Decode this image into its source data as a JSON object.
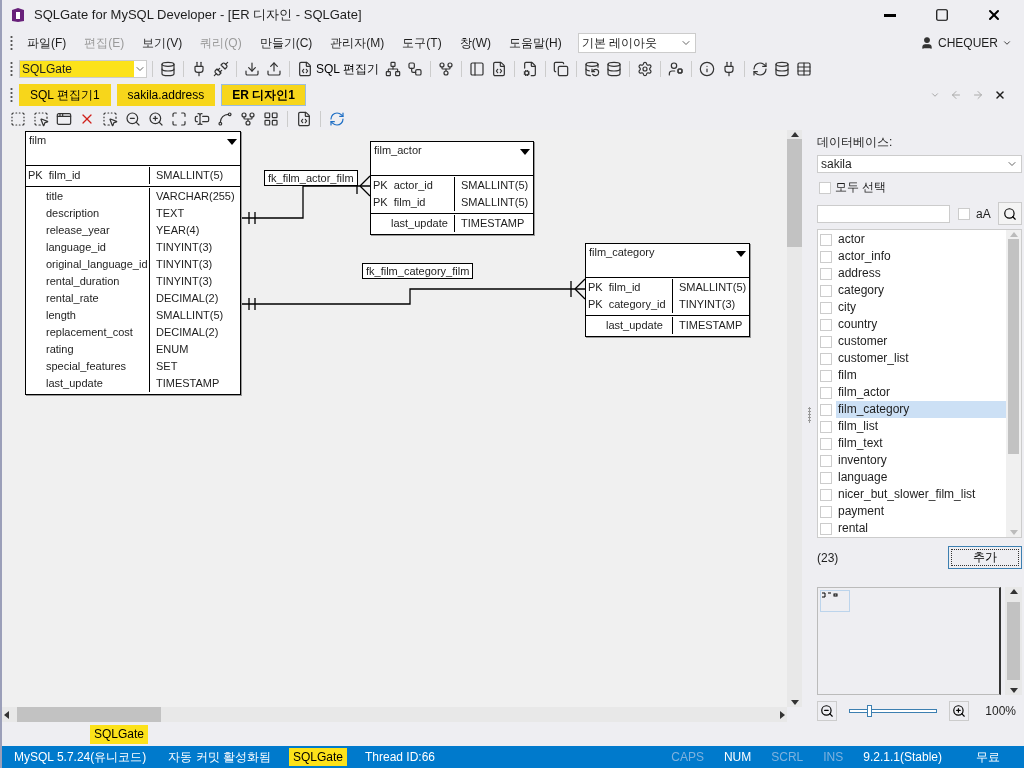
{
  "window": {
    "title": "SQLGate for MySQL Developer - [ER 디자인 - SQLGate]"
  },
  "menu": {
    "items": [
      {
        "label": "파일(F)",
        "disabled": false
      },
      {
        "label": "편집(E)",
        "disabled": true
      },
      {
        "label": "보기(V)",
        "disabled": false
      },
      {
        "label": "쿼리(Q)",
        "disabled": true
      },
      {
        "label": "만들기(C)",
        "disabled": false
      },
      {
        "label": "관리자(M)",
        "disabled": false
      },
      {
        "label": "도구(T)",
        "disabled": false
      },
      {
        "label": "창(W)",
        "disabled": false
      },
      {
        "label": "도움말(H)",
        "disabled": false
      }
    ],
    "layout_select": "기본 레이아웃",
    "user": "CHEQUER"
  },
  "toolbar": {
    "connection": "SQLGate",
    "sql_editor": "SQL 편집기"
  },
  "doc_tabs": [
    {
      "label": "SQL 편집기1",
      "selected": false
    },
    {
      "label": "sakila.address",
      "selected": false
    },
    {
      "label": "ER 디자인1",
      "selected": true
    }
  ],
  "er": {
    "tables": [
      {
        "name": "film",
        "columns": [
          {
            "key": "PK",
            "name": "film_id",
            "type": "SMALLINT(5)"
          },
          {
            "name": "title",
            "type": "VARCHAR(255)"
          },
          {
            "name": "description",
            "type": "TEXT"
          },
          {
            "name": "release_year",
            "type": "YEAR(4)"
          },
          {
            "name": "language_id",
            "type": "TINYINT(3)"
          },
          {
            "name": "original_language_id",
            "type": "TINYINT(3)"
          },
          {
            "name": "rental_duration",
            "type": "TINYINT(3)"
          },
          {
            "name": "rental_rate",
            "type": "DECIMAL(2)"
          },
          {
            "name": "length",
            "type": "SMALLINT(5)"
          },
          {
            "name": "replacement_cost",
            "type": "DECIMAL(2)"
          },
          {
            "name": "rating",
            "type": "ENUM"
          },
          {
            "name": "special_features",
            "type": "SET"
          },
          {
            "name": "last_update",
            "type": "TIMESTAMP"
          }
        ]
      },
      {
        "name": "film_actor",
        "columns": [
          {
            "key": "PK",
            "name": "actor_id",
            "type": "SMALLINT(5)"
          },
          {
            "key": "PK",
            "name": "film_id",
            "type": "SMALLINT(5)"
          },
          {
            "name": "last_update",
            "type": "TIMESTAMP"
          }
        ]
      },
      {
        "name": "film_category",
        "columns": [
          {
            "key": "PK",
            "name": "film_id",
            "type": "SMALLINT(5)"
          },
          {
            "key": "PK",
            "name": "category_id",
            "type": "TINYINT(3)"
          },
          {
            "name": "last_update",
            "type": "TIMESTAMP"
          }
        ]
      }
    ],
    "relations": [
      {
        "label": "fk_film_actor_film"
      },
      {
        "label": "fk_film_category_film"
      }
    ]
  },
  "side_panel": {
    "database_label": "데이터베이스:",
    "database": "sakila",
    "select_all": {
      "label": "모두 선택",
      "checked": false
    },
    "case_toggle": {
      "label": "aA",
      "checked": false
    },
    "tables": [
      {
        "name": "actor",
        "checked": false,
        "selected": false
      },
      {
        "name": "actor_info",
        "checked": false,
        "selected": false
      },
      {
        "name": "address",
        "checked": false,
        "selected": false
      },
      {
        "name": "category",
        "checked": false,
        "selected": false
      },
      {
        "name": "city",
        "checked": false,
        "selected": false
      },
      {
        "name": "country",
        "checked": false,
        "selected": false
      },
      {
        "name": "customer",
        "checked": false,
        "selected": false
      },
      {
        "name": "customer_list",
        "checked": false,
        "selected": false
      },
      {
        "name": "film",
        "checked": false,
        "selected": false
      },
      {
        "name": "film_actor",
        "checked": false,
        "selected": false
      },
      {
        "name": "film_category",
        "checked": false,
        "selected": true
      },
      {
        "name": "film_list",
        "checked": false,
        "selected": false
      },
      {
        "name": "film_text",
        "checked": false,
        "selected": false
      },
      {
        "name": "inventory",
        "checked": false,
        "selected": false
      },
      {
        "name": "language",
        "checked": false,
        "selected": false
      },
      {
        "name": "nicer_but_slower_film_list",
        "checked": false,
        "selected": false
      },
      {
        "name": "payment",
        "checked": false,
        "selected": false
      },
      {
        "name": "rental",
        "checked": false,
        "selected": false
      }
    ],
    "count": "(23)",
    "add_button": "추가",
    "zoom": {
      "level": 0.23,
      "reading": "100%"
    }
  },
  "bottom_tabs": [
    {
      "label": "SQLGate",
      "selected": true
    }
  ],
  "status_bar": {
    "left": [
      {
        "text": "MySQL 5.7.24(유니코드)",
        "kind": "plain"
      },
      {
        "text": "자동 커밋 활성화됨",
        "kind": "plain"
      },
      {
        "text": "SQLGate",
        "kind": "highlight"
      },
      {
        "text": "Thread ID:66",
        "kind": "plain"
      }
    ],
    "right": [
      {
        "text": "CAPS",
        "active": false
      },
      {
        "text": "NUM",
        "active": true
      },
      {
        "text": "SCRL",
        "active": false
      },
      {
        "text": "INS",
        "active": false
      },
      {
        "text": "9.2.1.1(Stable)",
        "active": true
      },
      {
        "text": "무료",
        "active": true
      }
    ]
  }
}
